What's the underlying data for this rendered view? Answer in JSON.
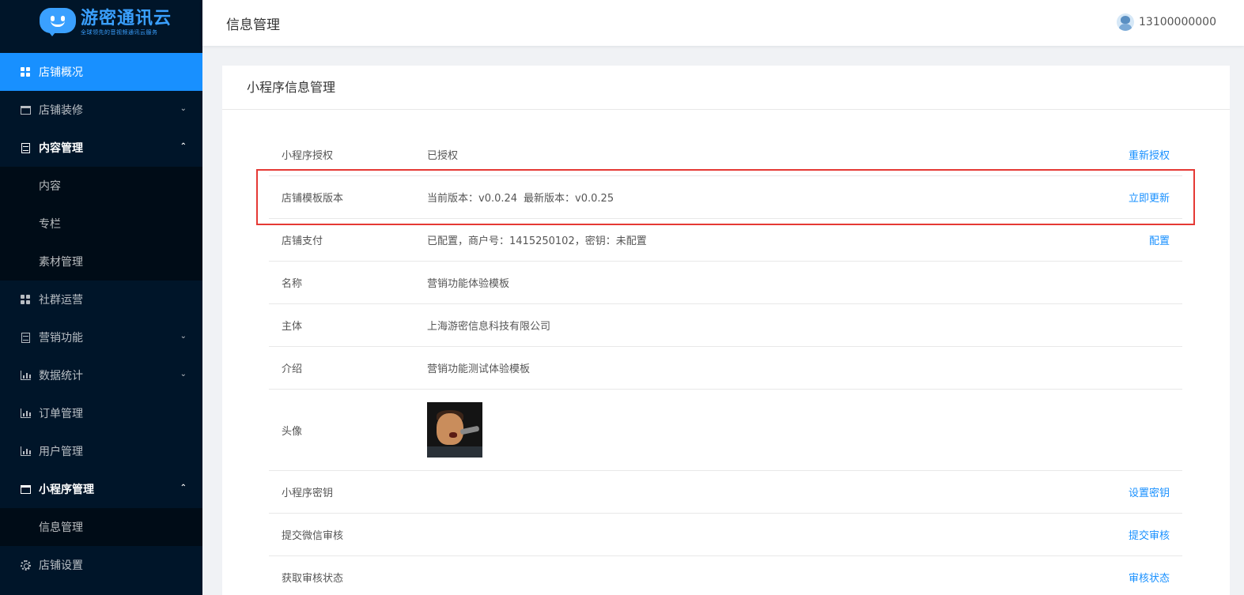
{
  "brand": {
    "title": "游密通讯云",
    "subtitle": "全球领先的音视频通讯云服务"
  },
  "header": {
    "title": "信息管理",
    "username": "13100000000"
  },
  "sidebar": {
    "items": [
      {
        "label": "店铺概况"
      },
      {
        "label": "店铺装修"
      },
      {
        "label": "内容管理"
      },
      {
        "label": "内容"
      },
      {
        "label": "专栏"
      },
      {
        "label": "素材管理"
      },
      {
        "label": "社群运营"
      },
      {
        "label": "营销功能"
      },
      {
        "label": "数据统计"
      },
      {
        "label": "订单管理"
      },
      {
        "label": "用户管理"
      },
      {
        "label": "小程序管理"
      },
      {
        "label": "信息管理"
      },
      {
        "label": "店铺设置"
      }
    ]
  },
  "card": {
    "title": "小程序信息管理",
    "rows": [
      {
        "label": "小程序授权",
        "value": "已授权",
        "action": "重新授权"
      },
      {
        "label": "店铺模板版本",
        "value": "当前版本：v0.0.24",
        "value2": "最新版本：v0.0.25",
        "action": "立即更新"
      },
      {
        "label": "店铺支付",
        "value": "已配置，商户号：1415250102，密钥：未配置",
        "action": "配置"
      },
      {
        "label": "名称",
        "value": "营销功能体验模板"
      },
      {
        "label": "主体",
        "value": "上海游密信息科技有限公司"
      },
      {
        "label": "介绍",
        "value": "营销功能测试体验模板"
      },
      {
        "label": "头像"
      },
      {
        "label": "小程序密钥",
        "action": "设置密钥"
      },
      {
        "label": "提交微信审核",
        "action": "提交审核"
      },
      {
        "label": "获取审核状态",
        "action": "审核状态"
      }
    ]
  },
  "colors": {
    "sidebar_bg": "#001529",
    "submenu_bg": "#000c17",
    "accent": "#1890ff",
    "highlight_border": "#e53935"
  }
}
